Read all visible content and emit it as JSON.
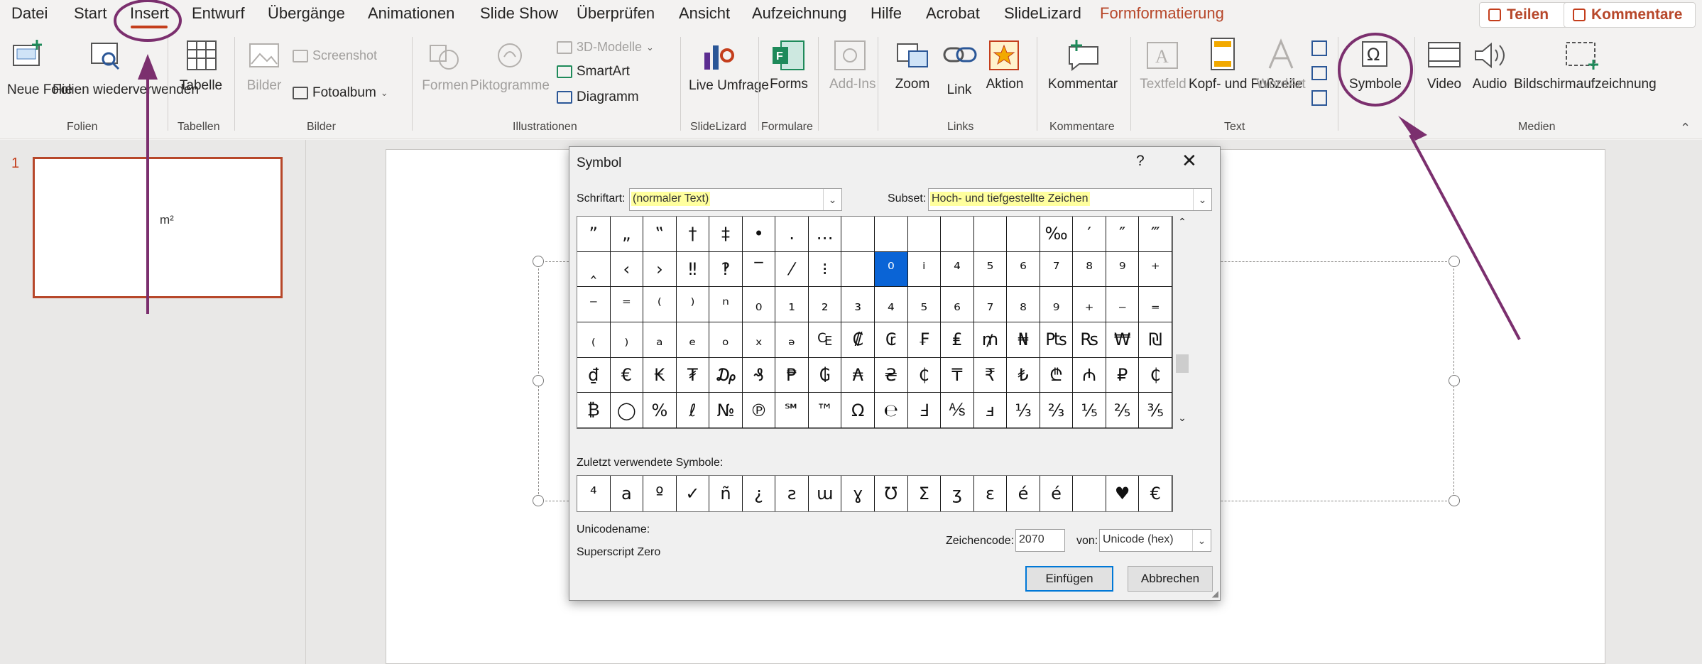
{
  "menu_tabs": [
    "Datei",
    "Start",
    "Insert",
    "Entwurf",
    "Übergänge",
    "Animationen",
    "Slide Show",
    "Überprüfen",
    "Ansicht",
    "Aufzeichnung",
    "Hilfe",
    "Acrobat",
    "SlideLizard",
    "Formformatierung"
  ],
  "share_label": "Teilen",
  "comments_label": "Kommentare",
  "ribbon": {
    "folien": {
      "new_slide": "Neue Folie",
      "reuse": "Folien wiederverwenden",
      "group": "Folien"
    },
    "tabellen": {
      "table": "Tabelle",
      "group": "Tabellen"
    },
    "bilder": {
      "pictures": "Bilder",
      "screenshot": "Screenshot",
      "album": "Fotoalbum",
      "group": "Bilder"
    },
    "illustrationen": {
      "shapes": "Formen",
      "icons": "Piktogramme",
      "models3d": "3D-Modelle",
      "smartart": "SmartArt",
      "chart": "Diagramm",
      "group": "Illustrationen"
    },
    "slidelizard": {
      "live": "Live Umfrage",
      "group": "SlideLizard"
    },
    "formulare": {
      "forms": "Forms",
      "group": "Formulare"
    },
    "addins": {
      "label": "Add-Ins"
    },
    "links": {
      "zoom": "Zoom",
      "link": "Link",
      "action": "Aktion",
      "group": "Links"
    },
    "kommentare": {
      "comment": "Kommentar",
      "group": "Kommentare"
    },
    "text": {
      "textbox": "Textfeld",
      "header_footer": "Kopf- und Fußzeile",
      "wordart": "WordArt",
      "group": "Text"
    },
    "symbole": {
      "label": "Symbole"
    },
    "medien": {
      "video": "Video",
      "audio": "Audio",
      "screen_rec": "Bildschirmaufzeichnung",
      "group": "Medien"
    }
  },
  "slides": [
    {
      "number": "1",
      "content": "m²"
    }
  ],
  "dialog": {
    "title": "Symbol",
    "help": "?",
    "font_label": "Schriftart:",
    "font_value": "(normaler Text)",
    "subset_label": "Subset:",
    "subset_value": "Hoch- und tiefgestellte Zeichen",
    "symbols": [
      "”",
      "„",
      "‟",
      "†",
      "‡",
      "•",
      "․",
      "…",
      "",
      "",
      "",
      "",
      "",
      "",
      "‰",
      "′",
      "″",
      "‴",
      "‸",
      "‹",
      "›",
      "‼",
      "‽",
      "‾",
      "⁄",
      "⁝",
      "",
      "⁰",
      "ⁱ",
      "⁴",
      "⁵",
      "⁶",
      "⁷",
      "⁸",
      "⁹",
      "⁺",
      "⁻",
      "⁼",
      "⁽",
      "⁾",
      "ⁿ",
      "₀",
      "₁",
      "₂",
      "₃",
      "₄",
      "₅",
      "₆",
      "₇",
      "₈",
      "₉",
      "₊",
      "₋",
      "₌",
      "₍",
      "₎",
      "ₐ",
      "ₑ",
      "ₒ",
      "ₓ",
      "ₔ",
      "₠",
      "₡",
      "₢",
      "₣",
      "₤",
      "₥",
      "₦",
      "₧",
      "₨",
      "₩",
      "₪",
      "₫",
      "€",
      "₭",
      "₮",
      "₯",
      "₰",
      "₱",
      "₲",
      "₳",
      "₴",
      "₵",
      "₸",
      "₹",
      "₺",
      "₾",
      "₼",
      "₽",
      "₵",
      "₿",
      "◯",
      "%",
      "ℓ",
      "№",
      "℗",
      "℠",
      "™",
      "Ω",
      "℮",
      "Ⅎ",
      "⅍",
      "ⅎ",
      "⅓",
      "⅔",
      "⅕",
      "⅖",
      "⅗"
    ],
    "selected_index": 27,
    "recent_label": "Zuletzt verwendete Symbole:",
    "recent": [
      "⁴",
      "a",
      "º",
      "✓",
      "ñ",
      "¿",
      "ƨ",
      "ɯ",
      "ɣ",
      "Ʊ",
      "Σ",
      "ʒ",
      "ɛ",
      "é",
      "é",
      "",
      "♥",
      "€"
    ],
    "unicode_name_label": "Unicodename:",
    "unicode_name": "Superscript Zero",
    "charcode_label": "Zeichencode:",
    "charcode": "2070",
    "from_label": "von:",
    "from_value": "Unicode (hex)",
    "insert_button": "Einfügen",
    "cancel_button": "Abbrechen"
  },
  "colors": {
    "accent": "#c43e1c",
    "annotation": "#7b2f6e",
    "selection": "#0a64d6",
    "highlight": "#ffff9e"
  }
}
